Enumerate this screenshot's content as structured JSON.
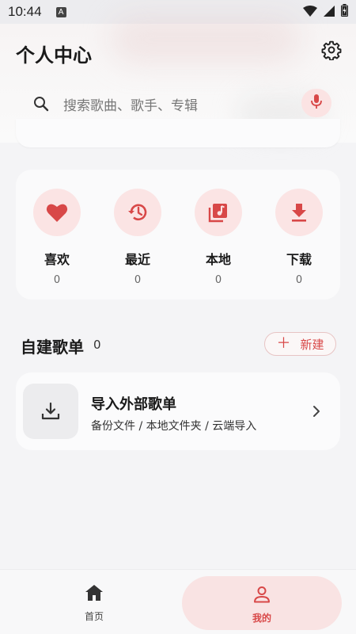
{
  "status_bar": {
    "time": "10:44",
    "badge": "A",
    "icons": [
      "wifi-icon",
      "signal-icon",
      "battery-icon"
    ]
  },
  "header": {
    "title": "个人中心",
    "settings_icon": "gear-icon"
  },
  "search": {
    "placeholder": "搜索歌曲、歌手、专辑",
    "icon": "search-icon",
    "mic_icon": "microphone-icon"
  },
  "quick_access": [
    {
      "label": "喜欢",
      "count": "0",
      "icon": "heart-icon"
    },
    {
      "label": "最近",
      "count": "0",
      "icon": "history-icon"
    },
    {
      "label": "本地",
      "count": "0",
      "icon": "music-library-icon"
    },
    {
      "label": "下载",
      "count": "0",
      "icon": "download-icon"
    }
  ],
  "playlists": {
    "title": "自建歌单",
    "count": "0",
    "new_label": "新建",
    "new_icon": "plus-icon"
  },
  "import_card": {
    "title": "导入外部歌单",
    "subtitle": "备份文件 / 本地文件夹 / 云端导入",
    "icon": "import-download-icon"
  },
  "bottom_nav": {
    "home_label": "首页",
    "mine_label": "我的",
    "active": "mine"
  },
  "colors": {
    "accent": "#d84848",
    "accent_soft": "#fbe4e4",
    "background": "#f4f4f6",
    "card": "#fafafb"
  }
}
